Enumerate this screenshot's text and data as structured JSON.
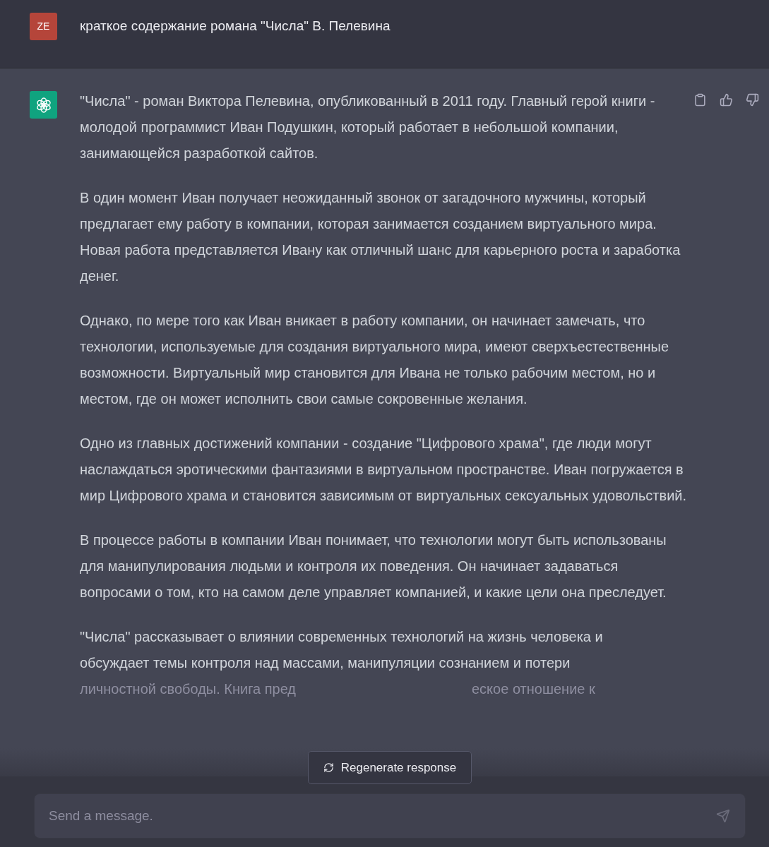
{
  "user_message": {
    "avatar": "ZE",
    "text": "краткое содержание романа \"Числа\" В. Пелевина"
  },
  "assistant_message": {
    "paragraphs": [
      "\"Числа\" - роман Виктора Пелевина, опубликованный в 2011 году. Главный герой книги - молодой программист Иван Подушкин, который работает в небольшой компании, занимающейся разработкой сайтов.",
      "В один момент Иван получает неожиданный звонок от загадочного мужчины, который предлагает ему работу в компании, которая занимается созданием виртуального мира. Новая работа представляется Ивану как отличный шанс для карьерного роста и заработка денег.",
      "Однако, по мере того как Иван вникает в работу компании, он начинает замечать, что технологии, используемые для создания виртуального мира, имеют сверхъестественные возможности. Виртуальный мир становится для Ивана не только рабочим местом, но и местом, где он может исполнить свои самые сокровенные желания.",
      "Одно из главных достижений компании - создание \"Цифрового храма\", где люди могут наслаждаться эротическими фантазиями в виртуальном пространстве. Иван погружается в мир Цифрового храма и становится зависимым от виртуальных сексуальных удовольствий.",
      "В процессе работы в компании Иван понимает, что технологии могут быть использованы для манипулирования людьми и контроля их поведения. Он начинает задаваться вопросами о том, кто на самом деле управляет компанией, и какие цели она преследует."
    ],
    "last_paragraph": {
      "lines": [
        "\"Числа\" рассказывает о влиянии современных технологий на жизнь человека и",
        "обсуждает темы контроля над массами, манипуляции сознанием и потери"
      ],
      "partial_left": "личностной свободы. Книга пред",
      "partial_right": "еское отношение к"
    }
  },
  "regenerate_button": {
    "label": "Regenerate response"
  },
  "composer": {
    "placeholder": "Send a message."
  }
}
